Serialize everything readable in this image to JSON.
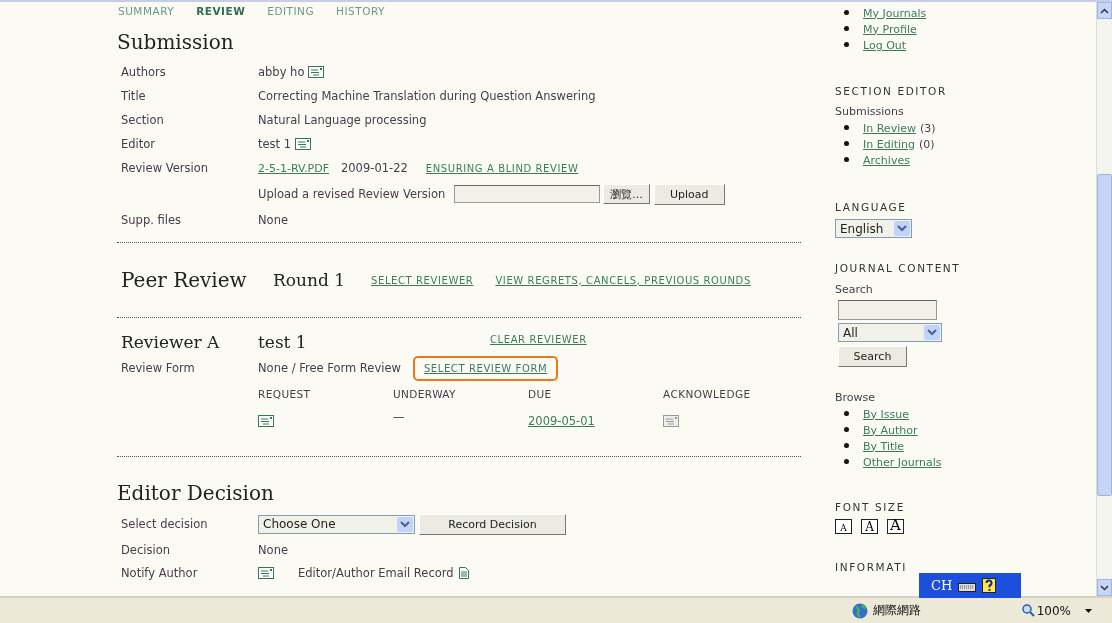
{
  "tabs": [
    {
      "label": "SUMMARY",
      "selected": false
    },
    {
      "label": "REVIEW",
      "selected": true
    },
    {
      "label": "EDITING",
      "selected": false
    },
    {
      "label": "HISTORY",
      "selected": false
    }
  ],
  "submission": {
    "heading": "Submission",
    "rows": [
      {
        "kind": "text",
        "label": "Authors",
        "value": "abby ho",
        "mail": true
      },
      {
        "kind": "text",
        "label": "Title",
        "value": "Correcting Machine Translation during Question Answering",
        "mail": false
      },
      {
        "kind": "text",
        "label": "Section",
        "value": "Natural Language processing",
        "mail": false
      },
      {
        "kind": "text",
        "label": "Editor",
        "value": "test 1",
        "mail": true
      },
      {
        "kind": "version",
        "label": "Review Version",
        "file": "2-5-1-RV.PDF",
        "date": "2009-01-22",
        "link": "ENSURING A BLIND REVIEW"
      },
      {
        "kind": "upload",
        "label": "Upload a revised Review Version",
        "browse": "瀏覽...",
        "button": "Upload"
      },
      {
        "kind": "text",
        "label": "Supp. files",
        "value": "None",
        "mail": false
      }
    ]
  },
  "peer_review": {
    "heading": "Peer Review",
    "round": "Round 1",
    "links": [
      "SELECT REVIEWER",
      "VIEW REGRETS, CANCELS, PREVIOUS ROUNDS"
    ]
  },
  "reviewer": {
    "heading": "Reviewer A",
    "name": "test 1",
    "clear_link": "CLEAR REVIEWER",
    "form_label": "Review Form",
    "form_value": "None / Free Form Review",
    "form_link": "SELECT REVIEW FORM",
    "form_link_highlighted": true,
    "columns": [
      "REQUEST",
      "UNDERWAY",
      "DUE",
      "ACKNOWLEDGE"
    ],
    "cells": [
      {
        "kind": "icon",
        "disabled": false
      },
      {
        "kind": "text",
        "text": "—"
      },
      {
        "kind": "link",
        "text": "2009-05-01"
      },
      {
        "kind": "icon",
        "disabled": true
      }
    ]
  },
  "editor_decision": {
    "heading": "Editor Decision",
    "select_label": "Select decision",
    "select_value": "Choose One",
    "record_button": "Record Decision",
    "decision_label": "Decision",
    "decision_value": "None",
    "notify_label": "Notify Author",
    "email_record": "Editor/Author Email Record"
  },
  "sidebar": {
    "user_links": [
      "My Journals",
      "My Profile",
      "Log Out"
    ],
    "section_editor": {
      "heading": "SECTION EDITOR",
      "subheading": "Submissions",
      "items": [
        {
          "label": "In Review",
          "count": "(3)"
        },
        {
          "label": "In Editing",
          "count": "(0)"
        },
        {
          "label": "Archives"
        }
      ]
    },
    "language": {
      "heading": "LANGUAGE",
      "value": "English"
    },
    "journal_content": {
      "heading": "JOURNAL CONTENT",
      "search_label": "Search",
      "scope": "All",
      "button": "Search"
    },
    "browse": {
      "heading": "Browse",
      "items": [
        "By Issue",
        "By Author",
        "By Title",
        "Other Journals"
      ]
    },
    "font_size": {
      "heading": "FONT SIZE",
      "sizes": [
        "A",
        "A",
        "A"
      ]
    },
    "information": {
      "heading": "INFORMATI"
    }
  },
  "language_bar": {
    "code": "CH"
  },
  "status_bar": {
    "zone": "網際網路",
    "zoom": "100%"
  }
}
